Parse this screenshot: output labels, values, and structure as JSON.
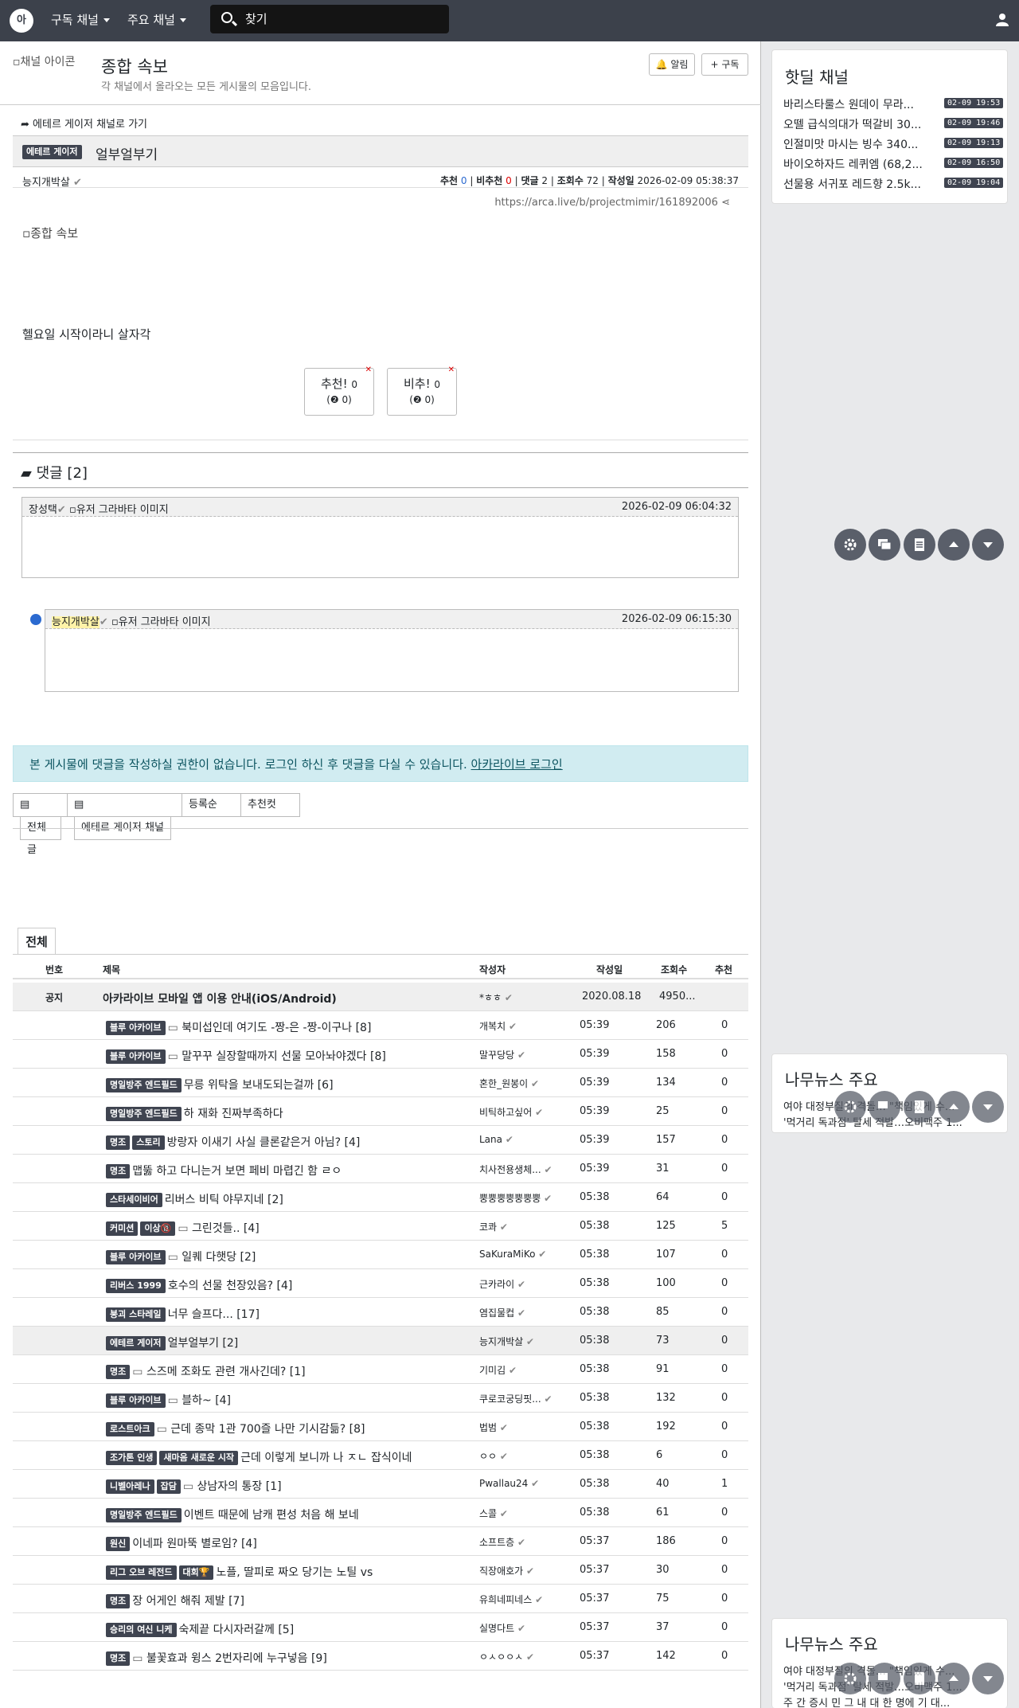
{
  "nav": {
    "logo": "아",
    "menu1": "구독 채널",
    "menu2": "주요 채널",
    "search": "찾기"
  },
  "channel": {
    "image_alt": "채널 아이콘",
    "title": "종합 속보",
    "desc": "각 채널에서 올라오는 모든 게시물의 모음입니다.",
    "alarm": "알림",
    "subscribe": "구독"
  },
  "post": {
    "go_channel": "에테르 게이저 채널로 가기",
    "category": "에테르 게이저",
    "title": "얼부얼부기",
    "author": "능지개박살",
    "rec_label": "추천",
    "rec": "0",
    "unrec_label": "비추천",
    "unrec": "0",
    "cmt_label": "댓글",
    "cmt": "2",
    "view_label": "조회수",
    "views": "72",
    "date_label": "작성일",
    "date": "2026-02-09 05:38:37",
    "url": "https://arca.live/b/projectmimir/161892006",
    "image_alt": "종합 속보",
    "body": "헬요일 시작이라니 살자각",
    "vote_up": "추천!",
    "vote_up_n": "0",
    "vote_up_sub": "0",
    "vote_down": "비추!",
    "vote_down_n": "0",
    "vote_down_sub": "0"
  },
  "comments": {
    "header": "댓글 [2]",
    "items": [
      {
        "author": "장성택",
        "avatar_alt": "유저 그라바타 이미지",
        "date": "2026-02-09 06:04:32"
      },
      {
        "author": "능지개박살",
        "avatar_alt": "유저 그라바타 이미지",
        "date": "2026-02-09 06:15:30"
      }
    ]
  },
  "notice": {
    "text": "본 게시물에 댓글을 작성하실 권한이 없습니다. 로그인 하신 후 댓글을 다실 수 있습니다.",
    "link": "아카라이브 로그인"
  },
  "tabs": {
    "all": "전체글",
    "channel": "에테르 게이저 채널",
    "order": "등록순",
    "best": "추천컷"
  },
  "list": {
    "tab": "전체",
    "headers": {
      "no": "번호",
      "title": "제목",
      "author": "작성자",
      "date": "작성일",
      "views": "조회수",
      "rec": "추천"
    },
    "notice_row": {
      "no": "공지",
      "title": "아카라이브 모바일 앱 이용 안내(iOS/Android)",
      "author": "*ㅎㅎ",
      "date": "2020.08.18",
      "views": "4950...",
      "rec": ""
    },
    "rows": [
      {
        "badges": [
          "블루 아카이브"
        ],
        "img": true,
        "title": "북미섭인데 여기도 -짱-은 -짱-이구나 [8]",
        "author": "개복치",
        "date": "05:39",
        "views": "206",
        "rec": "0"
      },
      {
        "badges": [
          "블루 아카이브"
        ],
        "img": true,
        "title": "말꾸꾸 실장할때까지 선물 모아놔야겠다 [8]",
        "author": "말꾸당당",
        "date": "05:39",
        "views": "158",
        "rec": "0"
      },
      {
        "badges": [
          "명일방주 엔드필드"
        ],
        "title": "무릉 위탁을 보내도되는걸까 [6]",
        "author": "혼한_원봉이",
        "date": "05:39",
        "views": "134",
        "rec": "0"
      },
      {
        "badges": [
          "명일방주 엔드필드"
        ],
        "title": "하 재화 진짜부족하다",
        "author": "비틱하고싶어",
        "date": "05:39",
        "views": "25",
        "rec": "0"
      },
      {
        "badges": [
          "명조",
          "스토리"
        ],
        "title": "방랑자 이새기 사실 클론같은거 아님? [4]",
        "author": "Lana",
        "date": "05:39",
        "views": "157",
        "rec": "0"
      },
      {
        "badges": [
          "명조"
        ],
        "title": "맵뚫 하고 다니는거 보면 페비 마렵긴 함 ㄹㅇ",
        "author": "치사전용생체...",
        "date": "05:39",
        "views": "31",
        "rec": "0"
      },
      {
        "badges": [
          "스타세이비어"
        ],
        "title": "리버스 비틱 야무지네 [2]",
        "author": "뿡뿡뿡뿡뿡뿡뿡",
        "date": "05:38",
        "views": "64",
        "rec": "0"
      },
      {
        "badges": [
          "커미션",
          "이상🔞"
        ],
        "img": true,
        "title": "그린것들.. [4]",
        "author": "코콰",
        "date": "05:38",
        "views": "125",
        "rec": "5"
      },
      {
        "badges": [
          "블루 아카이브"
        ],
        "img": true,
        "title": "일퀘 다햇당 [2]",
        "author": "SaKuraMiKo",
        "date": "05:38",
        "views": "107",
        "rec": "0"
      },
      {
        "badges": [
          "리버스 1999"
        ],
        "title": "호수의 선물 천장있음? [4]",
        "author": "근카라이",
        "date": "05:38",
        "views": "100",
        "rec": "0"
      },
      {
        "badges": [
          "붕괴 스타레일"
        ],
        "title": "너무 슬프다... [17]",
        "author": "염집물컵",
        "date": "05:38",
        "views": "85",
        "rec": "0"
      },
      {
        "badges": [
          "에테르 게이저"
        ],
        "title": "얼부얼부기 [2]",
        "author": "능지개박살",
        "date": "05:38",
        "views": "73",
        "rec": "0",
        "gray": true
      },
      {
        "badges": [
          "명조"
        ],
        "img": true,
        "title": "스즈메 조화도 관련 개사긴데? [1]",
        "author": "기미김",
        "date": "05:38",
        "views": "91",
        "rec": "0"
      },
      {
        "badges": [
          "블루 아카이브"
        ],
        "img": true,
        "title": "블하~ [4]",
        "author": "쿠로코궁딩핏...",
        "date": "05:38",
        "views": "132",
        "rec": "0"
      },
      {
        "badges": [
          "로스트아크"
        ],
        "img": true,
        "title": "근데 종막 1관 700즐 나만 기시감듦? [8]",
        "author": "법범",
        "date": "05:38",
        "views": "192",
        "rec": "0"
      },
      {
        "badges": [
          "조가톤 인생",
          "새마음 새로운 시작"
        ],
        "title": "근데 이렇게 보니까 나 ㅈㄴ 잡식이네",
        "author": "ㅇㅇ",
        "date": "05:38",
        "views": "6",
        "rec": "0"
      },
      {
        "badges": [
          "니벨아레나",
          "잡담"
        ],
        "img": true,
        "title": "상남자의 통장 [1]",
        "author": "Pwallau24",
        "date": "05:38",
        "views": "40",
        "rec": "1"
      },
      {
        "badges": [
          "명일방주 엔드필드"
        ],
        "title": "이벤트 때문에 남캐 편성 처음 해 보네",
        "author": "스콜",
        "date": "05:38",
        "views": "61",
        "rec": "0"
      },
      {
        "badges": [
          "원신"
        ],
        "title": "이네파 원마뚝 별로임? [4]",
        "author": "소프트층",
        "date": "05:37",
        "views": "186",
        "rec": "0"
      },
      {
        "badges": [
          "리그 오브 레전드",
          "대회🏆"
        ],
        "title": "노플, 딸피로 짜오 당기는 노틸 vs",
        "author": "직장애호가",
        "date": "05:37",
        "views": "30",
        "rec": "0"
      },
      {
        "badges": [
          "명조"
        ],
        "title": "장 어게인 해줘 제발 [7]",
        "author": "유희네피네스",
        "date": "05:37",
        "views": "75",
        "rec": "0"
      },
      {
        "badges": [
          "승리의 여신 니케"
        ],
        "title": "숙제끝 다시자러갈께 [5]",
        "author": "실명다트",
        "date": "05:37",
        "views": "37",
        "rec": "0"
      },
      {
        "badges": [
          "명조"
        ],
        "img": true,
        "title": "불꽃효과 윙스 2번자리에 누구넣음 [9]",
        "author": "ㅇㅅㅇㅇㅅ",
        "date": "05:37",
        "views": "142",
        "rec": "0"
      }
    ]
  },
  "side": {
    "hot_title": "핫딜 채널",
    "hot": [
      {
        "t": "바리스타룰스 원데이 무라...",
        "d": "02-09 19:53"
      },
      {
        "t": "오뗄 급식의대가 떡갈비 30...",
        "d": "02-09 19:46"
      },
      {
        "t": "인절미맛 마시는 빙수 340...",
        "d": "02-09 19:13"
      },
      {
        "t": "바이오하자드 레퀴엠 (68,2...",
        "d": "02-09 16:50"
      },
      {
        "t": "선물용 서귀포 레드향 2.5k...",
        "d": "02-09 19:04"
      }
    ],
    "news_title": "나무뉴스 주요",
    "news": [
      "여야 대정부질의 격돌… \"책임있게 수...",
      "'먹거리 독과점' 탈세 적발…오비맥주 1..."
    ],
    "news2": [
      "여야 대정부질의 격돌… \"책임있게 수...",
      "'먹거리 독과점' 탈세 적발…오비맥주 1...",
      "주 간 증시 민 그 내 대 한 명에 기 대..."
    ]
  }
}
